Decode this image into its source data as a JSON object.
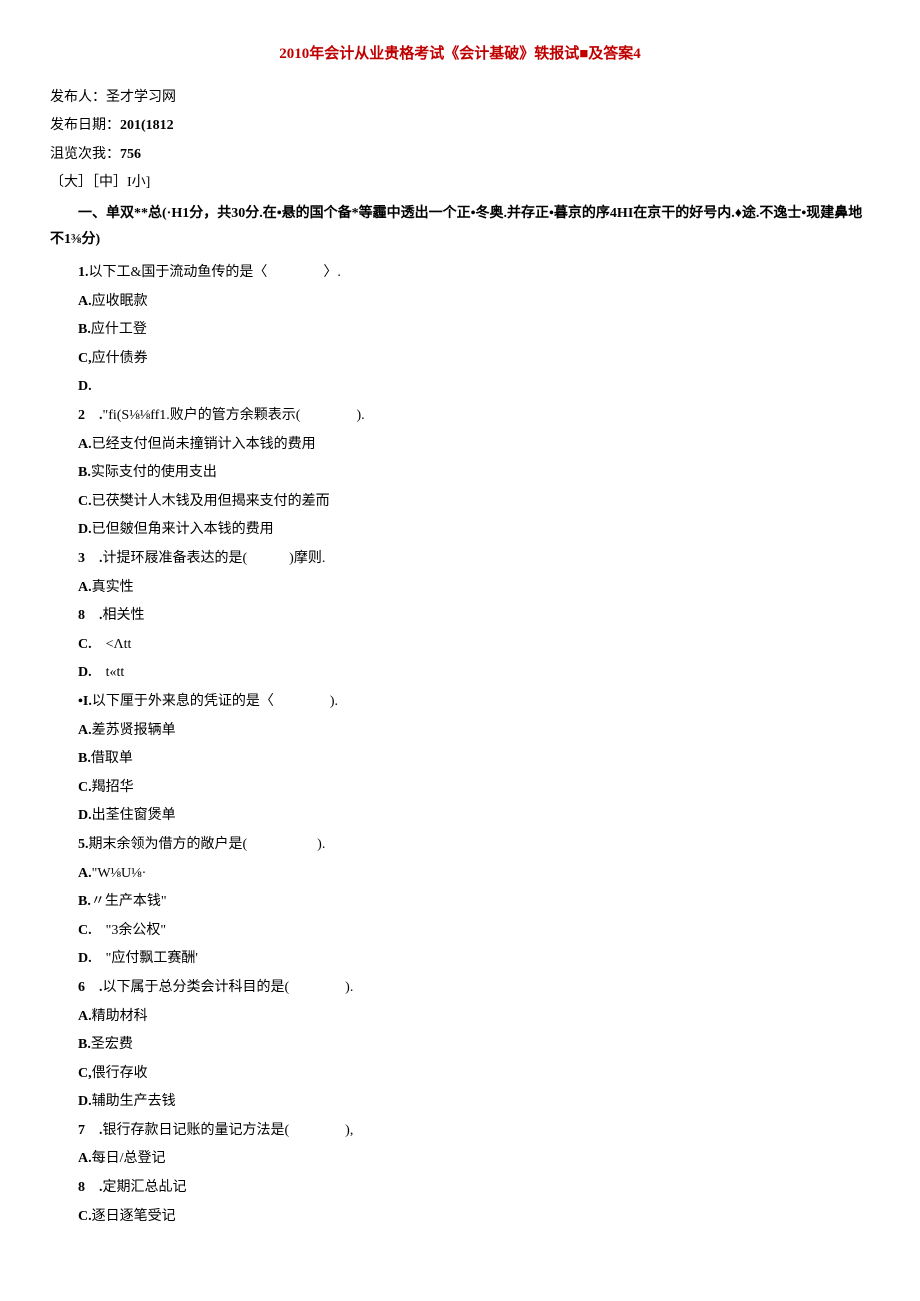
{
  "title": "2010年会计从业贵格考试《会计基破》轶报试■及答案4",
  "meta": {
    "publisher_label": "发布人：",
    "publisher": "圣才学习网",
    "date_label": "发布日期：",
    "date": "201(1812",
    "views_label": "沮览次我：",
    "views": "756",
    "size_options": "〔大］［中］I小]"
  },
  "intro": "一、单双**总(·H1分，共30分.在•悬的国个备*等霾中透出一个正•冬奥.并存正•暮京的序4HI在京干的好号内.♦途.不逸士•现建鼻地不1⅜分)",
  "questions": [
    {
      "num": "1.",
      "text": "以下工&国于流动鱼传的是〈　　　　〉.",
      "options": [
        {
          "label": "A.",
          "text": "应收眠款"
        },
        {
          "label": "B.",
          "text": "应什工登"
        },
        {
          "label": "C,",
          "text": "应什债券"
        },
        {
          "label": "D.",
          "text": ""
        }
      ]
    },
    {
      "num": "2　.",
      "text": "\"fi(S⅛⅛ff1.败户的管方余颗表示(　　　　).",
      "options": [
        {
          "label": "A.",
          "text": "已经支付但尚未撞销计入本钱的费用"
        },
        {
          "label": "B.",
          "text": "实际支付的使用支出"
        },
        {
          "label": "C.",
          "text": "已茯樊计人木钱及用但揭来支付的差而"
        },
        {
          "label": "D.",
          "text": "已但皴但角来计入本钱的费用"
        }
      ]
    },
    {
      "num": "3　.",
      "text": "计提环屐准备表达的是(　　　)摩则.",
      "options": [
        {
          "label": "A.",
          "text": "真实性"
        },
        {
          "label": "8　.",
          "text": "相关性"
        },
        {
          "label": "C.　",
          "text": "<Λtt"
        },
        {
          "label": "D.　",
          "text": "t«tt"
        }
      ]
    },
    {
      "num": "•I.",
      "text": "以下厘于外来息的凭证的是〈　　　　).",
      "options": [
        {
          "label": "A.",
          "text": "差苏贤报辆单"
        },
        {
          "label": "B.",
          "text": "借取单"
        },
        {
          "label": "C.",
          "text": "羯招华"
        },
        {
          "label": "D.",
          "text": "出荃住窗煲单"
        }
      ]
    },
    {
      "num": "5.",
      "text": "期末余领为借方的敞户是(　　　　　).",
      "options": [
        {
          "label": "A.",
          "text": "\"W⅛U⅛·"
        },
        {
          "label": "B.",
          "text": "〃生产本钱\""
        },
        {
          "label": "C.　",
          "text": "\"3余公权\""
        },
        {
          "label": "D.　",
          "text": "\"应付飘工赛酬'"
        }
      ]
    },
    {
      "num": "6　.",
      "text": "以下属于总分类会计科目的是(　　　　).",
      "options": [
        {
          "label": "A.",
          "text": "精助材科"
        },
        {
          "label": "B.",
          "text": "圣宏费"
        },
        {
          "label": "C,",
          "text": "偎行存收"
        },
        {
          "label": "D.",
          "text": "辅助生产去钱"
        }
      ]
    },
    {
      "num": "7　.",
      "text": "银行存款日记账的量记方法是(　　　　),",
      "options": [
        {
          "label": "A.",
          "text": "每日/总登记"
        },
        {
          "label": "8　.",
          "text": "定期汇总乩记"
        },
        {
          "label": "C.",
          "text": "逐日逐笔受记"
        }
      ]
    }
  ]
}
